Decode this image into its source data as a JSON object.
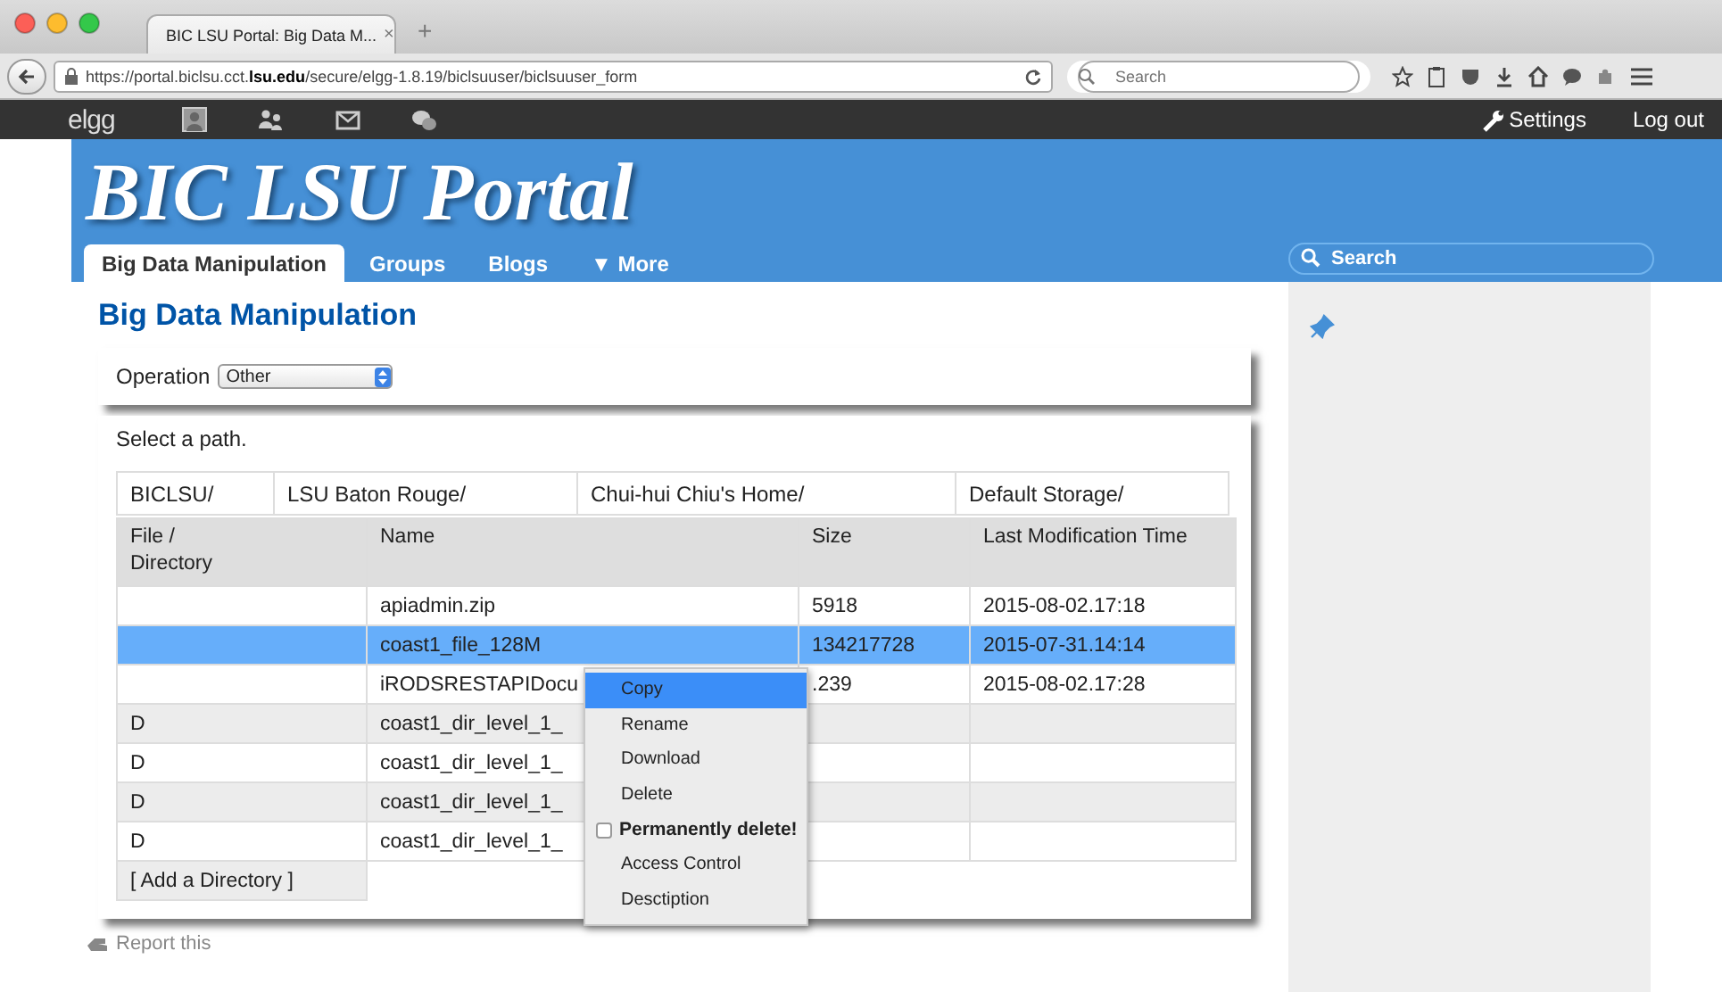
{
  "browser": {
    "tab_title": "BIC LSU Portal: Big Data M...",
    "tab_close": "×",
    "new_tab": "+",
    "url": "https://portal.biclsu.cct.**lsu.edu**/secure/elgg-1.8.19/biclsuuser/biclsuuser_form",
    "search_placeholder": "Search"
  },
  "topbar": {
    "logo": "elgg",
    "settings": "Settings",
    "logout": "Log out"
  },
  "header": {
    "site_title": "BIC LSU Portal",
    "tabs": [
      {
        "label": "Big Data Manipulation",
        "selected": true
      },
      {
        "label": "Groups",
        "selected": false
      },
      {
        "label": "Blogs",
        "selected": false
      },
      {
        "label": "▼ More",
        "selected": false
      }
    ],
    "search_placeholder": "Search"
  },
  "main": {
    "heading": "Big Data Manipulation",
    "operation_label": "Operation",
    "operation_value": "Other",
    "path_prompt": "Select a path.",
    "breadcrumbs": [
      "BICLSU/",
      "LSU Baton Rouge/",
      "Chui-hui Chiu's Home/",
      "Default Storage/"
    ],
    "columns": [
      "File / Directory",
      "Name",
      "Size",
      "Last Modification Time"
    ],
    "rows": [
      {
        "name": "apiadmin.zip",
        "size": "5918",
        "modified": "2015-08-02.17:18",
        "selected": false
      },
      {
        "name": "coast1_file_128M",
        "size": "134217728",
        "modified": "2015-07-31.14:14",
        "selected": true
      },
      {
        "name": "iRODSRESTAPIDocu",
        "size": ".239",
        "modified": "2015-08-02.17:28",
        "selected": false
      },
      {
        "type": "D",
        "name": "coast1_dir_level_1_",
        "selected": false
      },
      {
        "type": "D",
        "name": "coast1_dir_level_1_",
        "selected": false
      },
      {
        "type": "D",
        "name": "coast1_dir_level_1_",
        "selected": false
      },
      {
        "type": "D",
        "name": "coast1_dir_level_1_",
        "selected": false
      }
    ],
    "add_directory": "[ Add a Directory ]",
    "report": "Report this"
  },
  "context_menu": {
    "items": [
      {
        "kind": "action",
        "label": "Copy",
        "selected": true
      },
      {
        "kind": "action",
        "label": "Rename",
        "selected": false
      },
      {
        "kind": "action",
        "label": "Download",
        "selected": false
      },
      {
        "kind": "action",
        "label": "Delete",
        "selected": false
      },
      {
        "kind": "checkbox",
        "label": "Permanently delete!",
        "checked": false,
        "selected": false
      },
      {
        "kind": "action",
        "label": "Access Control",
        "selected": false
      },
      {
        "kind": "action",
        "label": "Desctiption",
        "selected": false
      }
    ]
  }
}
